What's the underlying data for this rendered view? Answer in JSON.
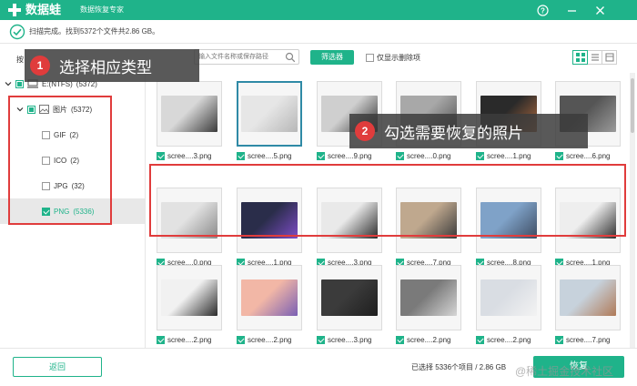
{
  "titlebar": {
    "app_name": "数据蛙",
    "app_subtitle": "数据恢复专家",
    "brand_color": "#1fb38a",
    "help_icon": "help-icon",
    "minimize_icon": "minimize-icon",
    "close_icon": "close-icon"
  },
  "status": {
    "text": "扫描完成。找到5372个文件共2.86 GB。"
  },
  "toolbar": {
    "view_label": "按",
    "search_placeholder": "输入文件名称或保存路径",
    "filter_label": "筛选器",
    "deleted_only_label": "仅显示删除项",
    "deleted_only_checked": false,
    "view_modes": [
      "grid-view-icon",
      "list-view-icon",
      "detail-view-icon"
    ],
    "active_view": "grid-view-icon"
  },
  "tree": {
    "drive": {
      "label": "E:(NTFS)",
      "count": "(5372)"
    },
    "category": {
      "label": "图片",
      "count": "(5372)"
    },
    "types": [
      {
        "label": "GIF",
        "count": "(2)",
        "checked": false
      },
      {
        "label": "ICO",
        "count": "(2)",
        "checked": false
      },
      {
        "label": "JPG",
        "count": "(32)",
        "checked": false
      },
      {
        "label": "PNG",
        "count": "(5336)",
        "checked": true
      }
    ]
  },
  "files": [
    {
      "name": "scree....3.png",
      "checked": true
    },
    {
      "name": "scree....5.png",
      "checked": true
    },
    {
      "name": "scree....9.png",
      "checked": true
    },
    {
      "name": "scree....0.png",
      "checked": true
    },
    {
      "name": "scree....1.png",
      "checked": true
    },
    {
      "name": "scree....6.png",
      "checked": true
    },
    {
      "name": "scree....0.png",
      "checked": true
    },
    {
      "name": "scree....1.png",
      "checked": true
    },
    {
      "name": "scree....3.png",
      "checked": true
    },
    {
      "name": "scree....7.png",
      "checked": true
    },
    {
      "name": "scree....8.png",
      "checked": true
    },
    {
      "name": "scree....1.png",
      "checked": true
    },
    {
      "name": "scree....2.png",
      "checked": true
    },
    {
      "name": "scree....2.png",
      "checked": true
    },
    {
      "name": "scree....3.png",
      "checked": true
    },
    {
      "name": "scree....2.png",
      "checked": true
    },
    {
      "name": "scree....2.png",
      "checked": true
    },
    {
      "name": "scree....7.png",
      "checked": true
    }
  ],
  "callouts": [
    {
      "num": "1",
      "text": "选择相应类型"
    },
    {
      "num": "2",
      "text": "勾选需要恢复的照片"
    }
  ],
  "footer": {
    "back_label": "返回",
    "selection_summary": "已选择 5336个项目 / 2.86 GB",
    "recover_label": "恢复",
    "watermark": "@稀土掘金技术社区"
  }
}
